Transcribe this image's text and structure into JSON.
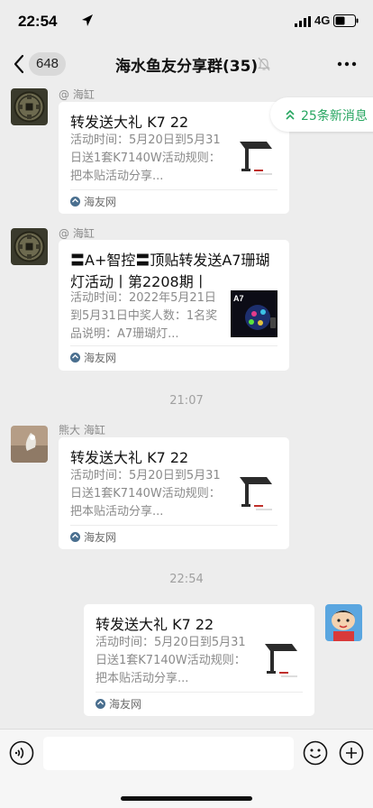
{
  "status_bar": {
    "time": "22:54",
    "network": "4G"
  },
  "header": {
    "back_count": "648",
    "title": "海水鱼友分享群(35)"
  },
  "new_messages": {
    "label": "25条新消息"
  },
  "messages": [
    {
      "sender": "@ 海缸",
      "title": "转发送大礼 K7 22",
      "description": "活动时间：5月20日到5月31日送1套K7140W活动规则：把本贴活动分享...",
      "source": "海友网"
    },
    {
      "sender": "@ 海缸",
      "title": "〓A+智控〓顶贴转发送A7珊瑚灯活动丨第2208期丨",
      "description": "活动时间：2022年5月21日到5月31日中奖人数：1名奖品说明：A7珊瑚灯...",
      "source": "海友网",
      "thumb_label": "A7"
    },
    {
      "sender": "熊大 海缸",
      "title": "转发送大礼 K7 22",
      "description": "活动时间：5月20日到5月31日送1套K7140W活动规则：把本贴活动分享...",
      "source": "海友网"
    },
    {
      "sender": "",
      "title": "转发送大礼 K7 22",
      "description": "活动时间：5月20日到5月31日送1套K7140W活动规则：把本贴活动分享...",
      "source": "海友网"
    }
  ],
  "timestamps": [
    "21:07",
    "22:54"
  ],
  "colors": {
    "background": "#ededed",
    "accent_green": "#26a660",
    "card": "#ffffff"
  }
}
